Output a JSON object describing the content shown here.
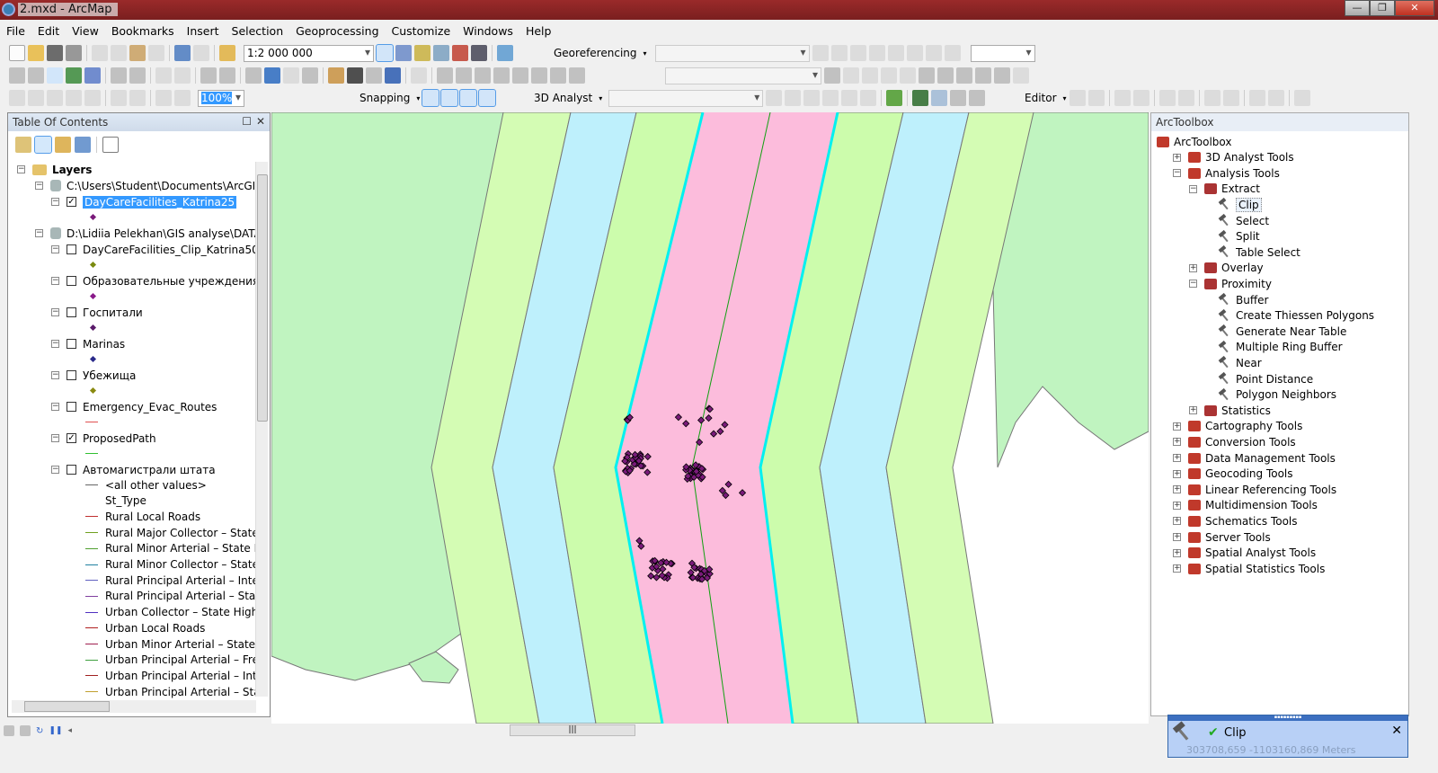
{
  "window": {
    "title": "2.mxd - ArcMap",
    "buttons": [
      "—",
      "❐",
      "✕"
    ]
  },
  "menu": [
    "File",
    "Edit",
    "View",
    "Bookmarks",
    "Insert",
    "Selection",
    "Geoprocessing",
    "Customize",
    "Windows",
    "Help"
  ],
  "toolbar": {
    "scale": "1:2 000 000",
    "georeferencing": "Georeferencing",
    "zoom_percent": "100%",
    "snapping": "Snapping",
    "analyst3d": "3D Analyst",
    "editor": "Editor"
  },
  "toc": {
    "title": "Table Of Contents",
    "rows": [
      {
        "type": "group",
        "label": "Layers",
        "expand": "−"
      },
      {
        "type": "source",
        "label": "C:\\Users\\Student\\Documents\\ArcGIS\\De",
        "expand": "−"
      },
      {
        "type": "layer",
        "label": "DayCareFacilities_Katrina25",
        "checked": true,
        "selected": true,
        "symbol": "point",
        "color": "#7a1a7a"
      },
      {
        "type": "source",
        "label": "D:\\Lidiia Pelekhan\\GIS analyse\\DATA\\lab",
        "expand": "−"
      },
      {
        "type": "layer",
        "label": "DayCareFacilities_Clip_Katrina50",
        "checked": false,
        "symbol": "point",
        "color": "#7a8a10"
      },
      {
        "type": "layer",
        "label": "Образовательные учреждения",
        "checked": false,
        "symbol": "point",
        "color": "#8a1a8a"
      },
      {
        "type": "layer",
        "label": "Госпитали",
        "checked": false,
        "symbol": "point",
        "color": "#5a1a6a"
      },
      {
        "type": "layer",
        "label": "Marinas",
        "checked": false,
        "symbol": "point",
        "color": "#2a2a8a"
      },
      {
        "type": "layer",
        "label": "Убежища",
        "checked": false,
        "symbol": "point",
        "color": "#8a8a10"
      },
      {
        "type": "layer",
        "label": "Emergency_Evac_Routes",
        "checked": false,
        "symbol": "line",
        "color": "#e05050"
      },
      {
        "type": "layer",
        "label": "ProposedPath",
        "checked": true,
        "symbol": "line",
        "color": "#30c030"
      },
      {
        "type": "layer",
        "label": "Автомагистрали штата",
        "checked": false,
        "symbol": "none"
      }
    ],
    "legend": [
      {
        "label": "<all other values>",
        "color": "#666666"
      },
      {
        "label": "St_Type",
        "color": null
      },
      {
        "label": "Rural Local Roads",
        "color": "#c03030"
      },
      {
        "label": "Rural Major Collector – State High",
        "color": "#70a020"
      },
      {
        "label": "Rural Minor Arterial – State Highw",
        "color": "#50a030"
      },
      {
        "label": "Rural Minor Collector – State High",
        "color": "#2080a0"
      },
      {
        "label": "Rural Principal Arterial – Interstate",
        "color": "#6060c0"
      },
      {
        "label": "Rural Principal Arterial – State Hig",
        "color": "#8040a0"
      },
      {
        "label": "Urban Collector – State Highways",
        "color": "#5030c0"
      },
      {
        "label": "Urban Local Roads",
        "color": "#b02020"
      },
      {
        "label": "Urban Minor Arterial – State Highw",
        "color": "#a02050"
      },
      {
        "label": "Urban Principal Arterial – Freeway",
        "color": "#40a040"
      },
      {
        "label": "Urban Principal Arterial – Interstat",
        "color": "#a02020"
      },
      {
        "label": "Urban Principal Arterial – State Hig",
        "color": "#c0a030"
      }
    ]
  },
  "map": {
    "colors": {
      "land": "#c0f4c0",
      "outer": "#d4fcb4",
      "blue": "#bef0fc",
      "green": "#ccfcac",
      "pink": "#fcbcdc",
      "cyan": "#00f0f0",
      "path": "#10a010",
      "points": "#7a1a7a"
    }
  },
  "toolbox": {
    "title": "ArcToolbox",
    "items": [
      {
        "level": 0,
        "kind": "root",
        "label": "ArcToolbox"
      },
      {
        "level": 1,
        "kind": "box",
        "label": "3D Analyst Tools",
        "expand": "+"
      },
      {
        "level": 1,
        "kind": "box",
        "label": "Analysis Tools",
        "expand": "−"
      },
      {
        "level": 2,
        "kind": "set",
        "label": "Extract",
        "expand": "−"
      },
      {
        "level": 3,
        "kind": "tool",
        "label": "Clip",
        "selected": true
      },
      {
        "level": 3,
        "kind": "tool",
        "label": "Select"
      },
      {
        "level": 3,
        "kind": "tool",
        "label": "Split"
      },
      {
        "level": 3,
        "kind": "tool",
        "label": "Table Select"
      },
      {
        "level": 2,
        "kind": "set",
        "label": "Overlay",
        "expand": "+"
      },
      {
        "level": 2,
        "kind": "set",
        "label": "Proximity",
        "expand": "−"
      },
      {
        "level": 3,
        "kind": "tool",
        "label": "Buffer"
      },
      {
        "level": 3,
        "kind": "tool",
        "label": "Create Thiessen Polygons"
      },
      {
        "level": 3,
        "kind": "tool",
        "label": "Generate Near Table"
      },
      {
        "level": 3,
        "kind": "tool",
        "label": "Multiple Ring Buffer"
      },
      {
        "level": 3,
        "kind": "tool",
        "label": "Near"
      },
      {
        "level": 3,
        "kind": "tool",
        "label": "Point Distance"
      },
      {
        "level": 3,
        "kind": "tool",
        "label": "Polygon Neighbors"
      },
      {
        "level": 2,
        "kind": "set",
        "label": "Statistics",
        "expand": "+"
      },
      {
        "level": 1,
        "kind": "box",
        "label": "Cartography Tools",
        "expand": "+"
      },
      {
        "level": 1,
        "kind": "box",
        "label": "Conversion Tools",
        "expand": "+"
      },
      {
        "level": 1,
        "kind": "box",
        "label": "Data Management Tools",
        "expand": "+"
      },
      {
        "level": 1,
        "kind": "box",
        "label": "Geocoding Tools",
        "expand": "+"
      },
      {
        "level": 1,
        "kind": "box",
        "label": "Linear Referencing Tools",
        "expand": "+"
      },
      {
        "level": 1,
        "kind": "box",
        "label": "Multidimension Tools",
        "expand": "+"
      },
      {
        "level": 1,
        "kind": "box",
        "label": "Schematics Tools",
        "expand": "+"
      },
      {
        "level": 1,
        "kind": "box",
        "label": "Server Tools",
        "expand": "+"
      },
      {
        "level": 1,
        "kind": "box",
        "label": "Spatial Analyst Tools",
        "expand": "+"
      },
      {
        "level": 1,
        "kind": "box",
        "label": "Spatial Statistics Tools",
        "expand": "+"
      }
    ]
  },
  "popup": {
    "tool": "Clip",
    "status": "completed",
    "coords": "303708,659  -1103160,869 Meters",
    "close": "✕"
  }
}
